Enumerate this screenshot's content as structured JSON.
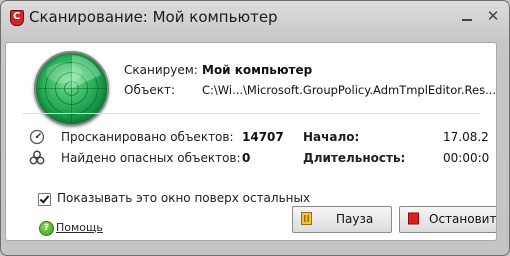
{
  "window": {
    "title": "Сканирование: Мой компьютер",
    "minimize_glyph": "",
    "close_glyph": "✕"
  },
  "scan": {
    "scanning_label": "Сканируем:",
    "scanning_value": "Мой компьютер",
    "object_label": "Объект:",
    "object_value": "C:\\Wi...\\Microsoft.GroupPolicy.AdmTmplEditor.Res..."
  },
  "stats": {
    "scanned_label": "Просканировано объектов:",
    "scanned_value": "14707",
    "found_label": "Найдено опасных объектов:",
    "found_value": "0",
    "start_label": "Начало:",
    "start_value": "17.08.2",
    "duration_label": "Длительность:",
    "duration_value": "00:00:0"
  },
  "options": {
    "on_top_label": "Показывать это окно поверх остальных",
    "on_top_checked": true
  },
  "buttons": {
    "pause": "Пауза",
    "stop": "Остановить"
  },
  "help": {
    "label": "Помощь"
  },
  "icons": {
    "app": "comodo-shield-icon",
    "radar": "radar-scan-icon",
    "gauge": "gauge-icon",
    "biohazard": "biohazard-icon",
    "pause": "pause-icon",
    "stop": "stop-icon",
    "help": "help-icon"
  },
  "colors": {
    "radar_green": "#18984a",
    "pause_icon": "#e0a21a",
    "stop_icon": "#d41a1a"
  }
}
